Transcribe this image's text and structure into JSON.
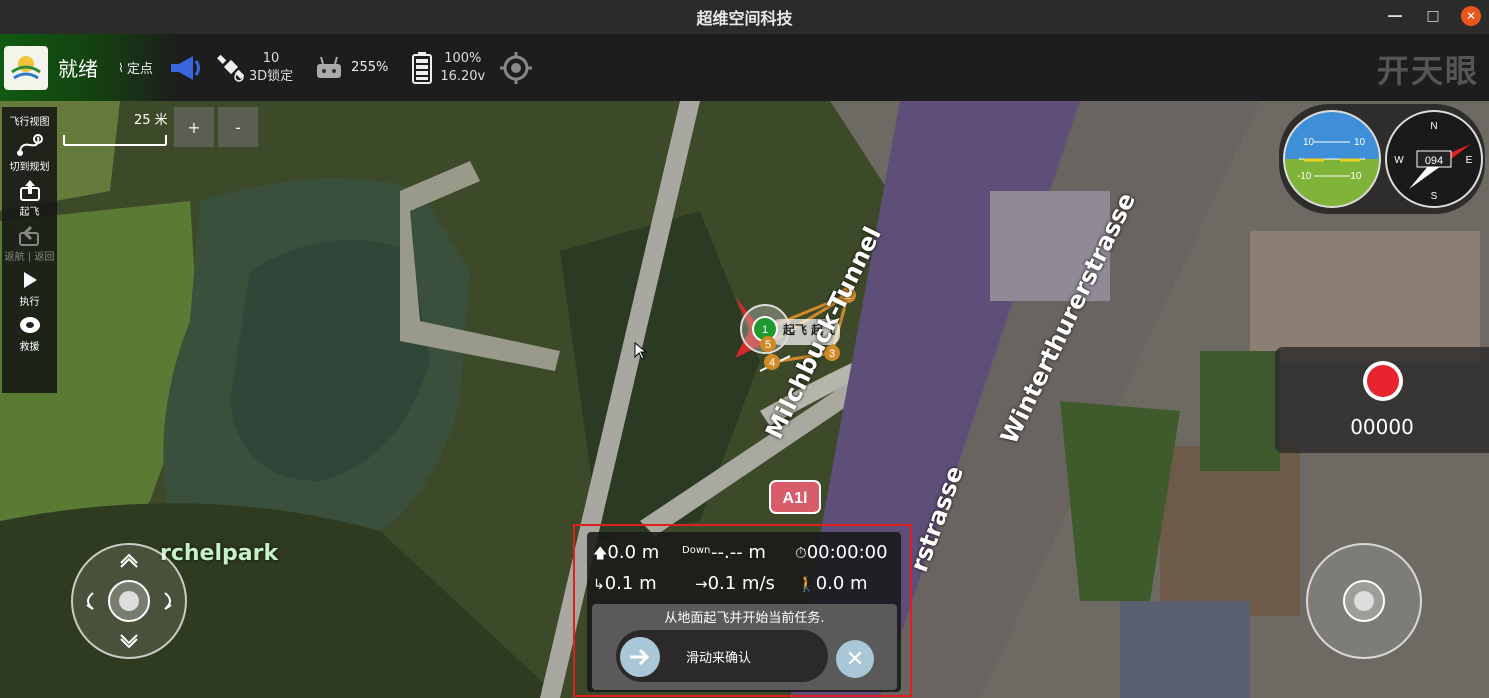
{
  "window": {
    "title": "超维空间科技"
  },
  "toolbar": {
    "status": "就绪",
    "flight_mode": "定点",
    "satellites": "10",
    "gps_lock": "3D锁定",
    "rc_signal": "255%",
    "battery_percent": "100%",
    "battery_voltage": "16.20v",
    "brand": "开天眼"
  },
  "rail": {
    "items": [
      {
        "label": "飞行视图",
        "icon": "plane-view-icon"
      },
      {
        "label": "切到规划",
        "icon": "route-plan-icon"
      },
      {
        "label": "起飞",
        "icon": "takeoff-icon"
      },
      {
        "label": "返航 | 返回",
        "icon": "return-home-icon",
        "disabled": true
      },
      {
        "label": "执行",
        "icon": "play-icon"
      },
      {
        "label": "救援",
        "icon": "lifebuoy-icon"
      }
    ]
  },
  "map": {
    "scale_label": "25 米",
    "zoom_in": "+",
    "zoom_out": "-",
    "labels": {
      "tunnel": "Milchbuck-Tunnel",
      "street1": "Winterthurerstrasse",
      "street2": "rstrasse",
      "park": "rchelpark",
      "road_sign": "A1l"
    },
    "waypoints": [
      "1",
      "2",
      "3",
      "4",
      "5"
    ],
    "vehicle_label": "起飞 起飞"
  },
  "instruments": {
    "attitude_marks": [
      "10",
      "10",
      "-10",
      "-10"
    ],
    "heading": "094",
    "compass": [
      "N",
      "E",
      "S",
      "W"
    ]
  },
  "record": {
    "counter": "00000"
  },
  "telemetry": {
    "altitude": "0.0 m",
    "down_label": "Down",
    "down_value": "--.-- m",
    "flight_time": "00:00:00",
    "horizontal_dist": "0.1 m",
    "speed": "0.1 m/s",
    "distance_home": "0.0 m",
    "confirm_message": "从地面起飞并开始当前任务.",
    "slider_label": "滑动来确认"
  },
  "colors": {
    "accent_red": "#e02020",
    "record_red": "#e8242f",
    "knob_blue": "#a9c7d6"
  }
}
